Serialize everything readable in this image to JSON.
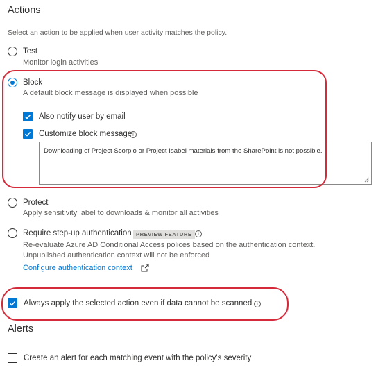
{
  "actions": {
    "heading": "Actions",
    "description": "Select an action to be applied when user activity matches the policy.",
    "test": {
      "label": "Test",
      "sub": "Monitor login activities"
    },
    "block": {
      "label": "Block",
      "sub": "A default block message is displayed when possible",
      "notify_label": "Also notify user by email",
      "customize_label": "Customize block message",
      "message": "Downloading of Project Scorpio or Project Isabel materials from the SharePoint is not possible."
    },
    "protect": {
      "label": "Protect",
      "sub": "Apply sensitivity label to downloads & monitor all activities"
    },
    "stepup": {
      "label": "Require step-up authentication",
      "badge": "PREVIEW FEATURE",
      "line1": "Re-evaluate Azure AD Conditional Access polices based on the authentication context.",
      "line2": "Unpublished authentication context will not be enforced",
      "link": "Configure authentication context"
    },
    "always_apply": "Always apply the selected action even if data cannot be scanned"
  },
  "alerts": {
    "heading": "Alerts",
    "create_alert": "Create an alert for each matching event with the policy's severity"
  },
  "colors": {
    "accent": "#0078d4",
    "highlight": "#d42a3a"
  }
}
